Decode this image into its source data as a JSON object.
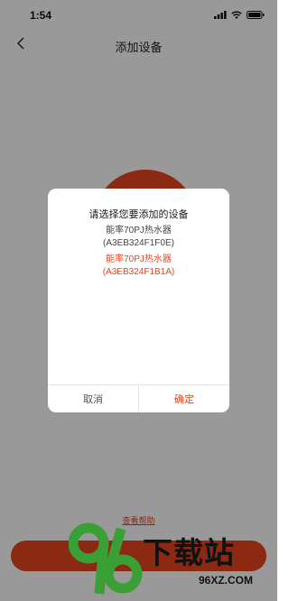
{
  "status_bar": {
    "time": "1:54",
    "icons": [
      "signal-icon",
      "wifi-icon",
      "battery-icon"
    ]
  },
  "navbar": {
    "back_icon": "chevron-left-icon",
    "title": "添加设备"
  },
  "page": {
    "help_link": "查看帮助",
    "bottom_button": ""
  },
  "dialog": {
    "title": "请选择您要添加的设备",
    "devices": [
      {
        "name": "能率70PJ热水器",
        "mac": "(A3EB324F1F0E)",
        "selected": false
      },
      {
        "name": "能率70PJ热水器",
        "mac": "(A3EB324F1B1A)",
        "selected": true
      }
    ],
    "cancel_label": "取消",
    "confirm_label": "确定"
  },
  "watermark": {
    "logo_text": "下载站",
    "url": "96XZ.COM"
  },
  "colors": {
    "accent": "#e8451f",
    "overlay": "rgba(0,0,0,0.4)",
    "watermark_green": "#3aa035"
  }
}
